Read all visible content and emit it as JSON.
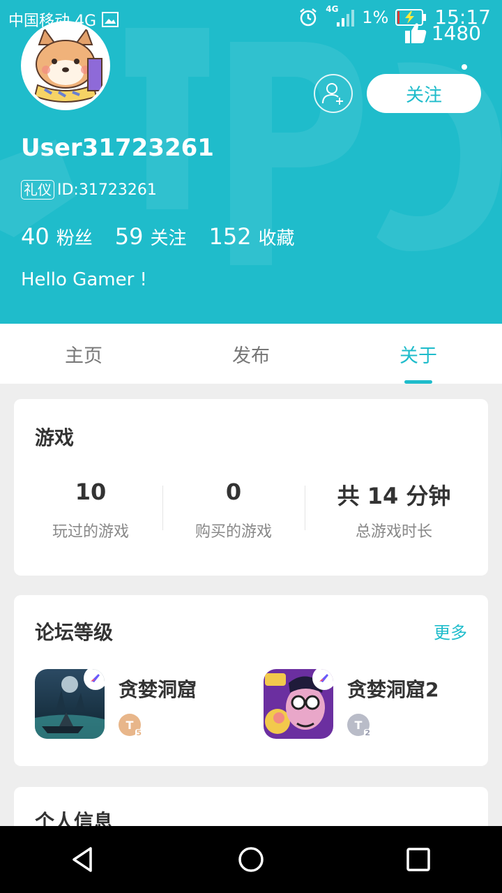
{
  "status_bar": {
    "carrier": "中国移动 4G",
    "network_small": "4G",
    "battery_pct": "1%",
    "time": "15:17"
  },
  "profile": {
    "like_count": "1480",
    "follow_label": "关注",
    "username": "User31723261",
    "badge": "礼仪",
    "id_text": "ID:31723261",
    "stats": [
      {
        "num": "40",
        "label": "粉丝"
      },
      {
        "num": "59",
        "label": "关注"
      },
      {
        "num": "152",
        "label": "收藏"
      }
    ],
    "bio": "Hello Gamer !"
  },
  "tabs": [
    {
      "label": "主页"
    },
    {
      "label": "发布"
    },
    {
      "label": "关于"
    }
  ],
  "active_tab": 2,
  "games_card": {
    "title": "游戏",
    "stats": [
      {
        "num": "10",
        "label": "玩过的游戏"
      },
      {
        "num": "0",
        "label": "购买的游戏"
      },
      {
        "num": "共 14 分钟",
        "label": "总游戏时长"
      }
    ]
  },
  "forum_card": {
    "title": "论坛等级",
    "more_label": "更多",
    "items": [
      {
        "name": "贪婪洞窟",
        "medal_letter": "T",
        "medal_level": "5",
        "medal_color": "#e8b68a"
      },
      {
        "name": "贪婪洞窟2",
        "medal_letter": "T",
        "medal_level": "2",
        "medal_color": "#b9bcc8"
      }
    ]
  },
  "info_card": {
    "title": "个人信息"
  },
  "colors": {
    "accent": "#1fbccb"
  }
}
